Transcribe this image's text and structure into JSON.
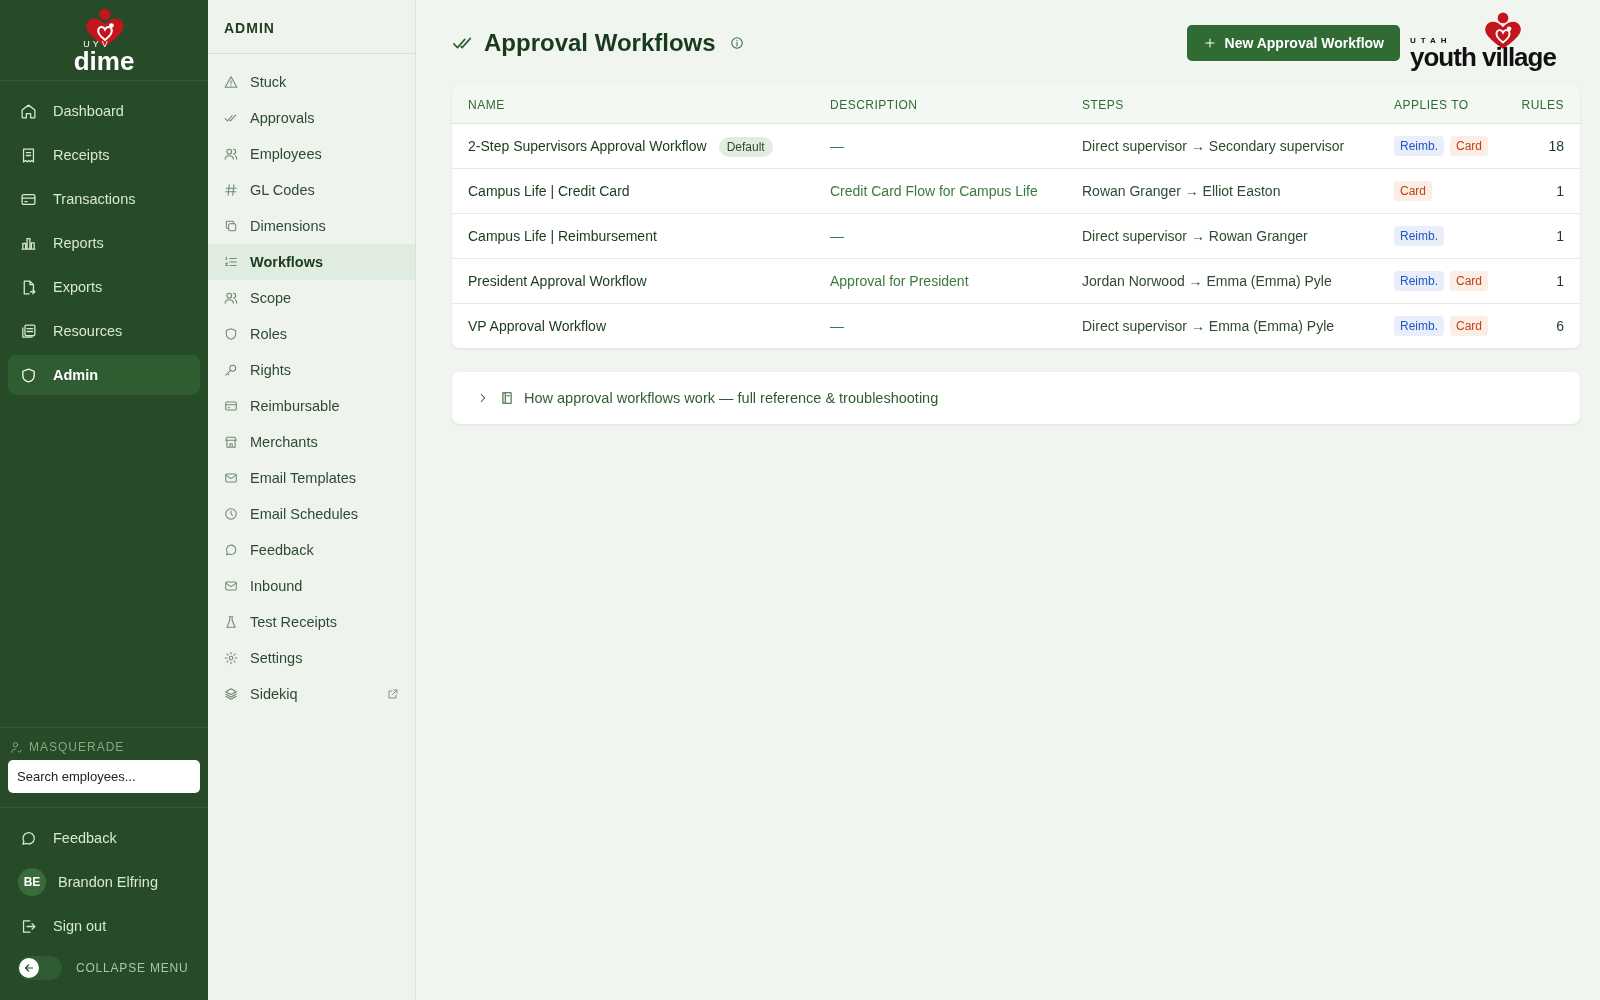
{
  "sidebar": {
    "logo": {
      "small": "UYV",
      "word": "dime"
    },
    "nav": [
      {
        "label": "Dashboard",
        "selected": false
      },
      {
        "label": "Receipts",
        "selected": false
      },
      {
        "label": "Transactions",
        "selected": false
      },
      {
        "label": "Reports",
        "selected": false
      },
      {
        "label": "Exports",
        "selected": false
      },
      {
        "label": "Resources",
        "selected": false
      },
      {
        "label": "Admin",
        "selected": true
      }
    ],
    "masquerade": {
      "label": "MASQUERADE",
      "placeholder": "Search employees..."
    },
    "feedback": "Feedback",
    "user": {
      "initials": "BE",
      "name": "Brandon Elfring"
    },
    "sign_out": "Sign out",
    "collapse": {
      "label": "COLLAPSE MENU",
      "on": false
    }
  },
  "admin_menu": {
    "heading": "ADMIN",
    "items": [
      {
        "label": "Stuck",
        "selected": false,
        "external": false
      },
      {
        "label": "Approvals",
        "selected": false,
        "external": false
      },
      {
        "label": "Employees",
        "selected": false,
        "external": false
      },
      {
        "label": "GL Codes",
        "selected": false,
        "external": false
      },
      {
        "label": "Dimensions",
        "selected": false,
        "external": false
      },
      {
        "label": "Workflows",
        "selected": true,
        "external": false
      },
      {
        "label": "Scope",
        "selected": false,
        "external": false
      },
      {
        "label": "Roles",
        "selected": false,
        "external": false
      },
      {
        "label": "Rights",
        "selected": false,
        "external": false
      },
      {
        "label": "Reimbursable",
        "selected": false,
        "external": false
      },
      {
        "label": "Merchants",
        "selected": false,
        "external": false
      },
      {
        "label": "Email Templates",
        "selected": false,
        "external": false
      },
      {
        "label": "Email Schedules",
        "selected": false,
        "external": false
      },
      {
        "label": "Feedback",
        "selected": false,
        "external": false
      },
      {
        "label": "Inbound",
        "selected": false,
        "external": false
      },
      {
        "label": "Test Receipts",
        "selected": false,
        "external": false
      },
      {
        "label": "Settings",
        "selected": false,
        "external": false
      },
      {
        "label": "Sidekiq",
        "selected": false,
        "external": true
      }
    ]
  },
  "page": {
    "title": "Approval Workflows",
    "new_button": "New Approval Workflow",
    "brand": {
      "small": "UTAH",
      "word": "youth village"
    }
  },
  "table": {
    "columns": [
      "NAME",
      "DESCRIPTION",
      "STEPS",
      "APPLIES TO",
      "RULES"
    ],
    "rows": [
      {
        "name": "2-Step Supervisors Approval Workflow",
        "badge": "Default",
        "description": "—",
        "steps": "Direct supervisor → Secondary supervisor",
        "applies_to": [
          {
            "label": "Reimb.",
            "kind": "reimb"
          },
          {
            "label": "Card",
            "kind": "card"
          }
        ],
        "rules": "18"
      },
      {
        "name": "Campus Life | Credit Card",
        "description": "Credit Card Flow for Campus Life",
        "steps": "Rowan Granger → Elliot Easton",
        "applies_to": [
          {
            "label": "Card",
            "kind": "card"
          }
        ],
        "rules": "1"
      },
      {
        "name": "Campus Life | Reimbursement",
        "description": "—",
        "steps": "Direct supervisor → Rowan Granger",
        "applies_to": [
          {
            "label": "Reimb.",
            "kind": "reimb"
          }
        ],
        "rules": "1"
      },
      {
        "name": "President Approval Workflow",
        "description": "Approval for President",
        "steps": "Jordan Norwood → Emma (Emma) Pyle",
        "applies_to": [
          {
            "label": "Reimb.",
            "kind": "reimb"
          },
          {
            "label": "Card",
            "kind": "card"
          }
        ],
        "rules": "1"
      },
      {
        "name": "VP Approval Workflow",
        "description": "—",
        "steps": "Direct supervisor → Emma (Emma) Pyle",
        "applies_to": [
          {
            "label": "Reimb.",
            "kind": "reimb"
          },
          {
            "label": "Card",
            "kind": "card"
          }
        ],
        "rules": "6"
      }
    ]
  },
  "reference": {
    "label": "How approval workflows work — full reference & troubleshooting",
    "expanded": false
  }
}
